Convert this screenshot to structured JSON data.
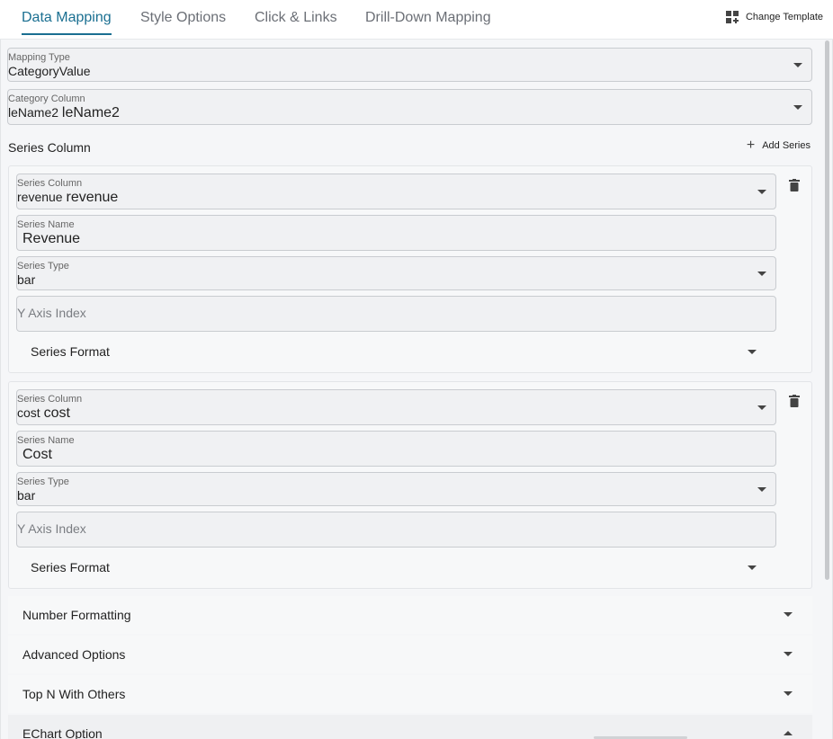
{
  "tabs": [
    {
      "label": "Data Mapping",
      "active": true
    },
    {
      "label": "Style Options",
      "active": false
    },
    {
      "label": "Click & Links",
      "active": false
    },
    {
      "label": "Drill-Down Mapping",
      "active": false
    }
  ],
  "change_template_label": "Change Template",
  "mapping_type": {
    "label": "Mapping Type",
    "value": "CategoryValue"
  },
  "category_column": {
    "label": "Category Column",
    "value_small": "leName2",
    "value_large": "leName2"
  },
  "series_section": {
    "title": "Series Column",
    "add_label": "Add Series"
  },
  "series": [
    {
      "column_label": "Series Column",
      "column_small": "revenue",
      "column_large": "revenue",
      "name_label": "Series Name",
      "name_value": "Revenue",
      "type_label": "Series Type",
      "type_value": "bar",
      "yaxis_placeholder": "Y Axis Index",
      "format_label": "Series Format"
    },
    {
      "column_label": "Series Column",
      "column_small": "cost",
      "column_large": "cost",
      "name_label": "Series Name",
      "name_value": "Cost",
      "type_label": "Series Type",
      "type_value": "bar",
      "yaxis_placeholder": "Y Axis Index",
      "format_label": "Series Format"
    }
  ],
  "sections": {
    "number_formatting": "Number Formatting",
    "advanced_options": "Advanced Options",
    "top_n": "Top N With Others",
    "echart_option": "EChart Option"
  },
  "colors": {
    "accent": "#1a6f91",
    "panel": "#f5f6f8"
  },
  "icons": {
    "change_template": "grid-plus-icon",
    "add": "plus-icon",
    "delete": "trash-icon",
    "expand": "caret-down-icon",
    "collapse": "caret-up-icon"
  }
}
